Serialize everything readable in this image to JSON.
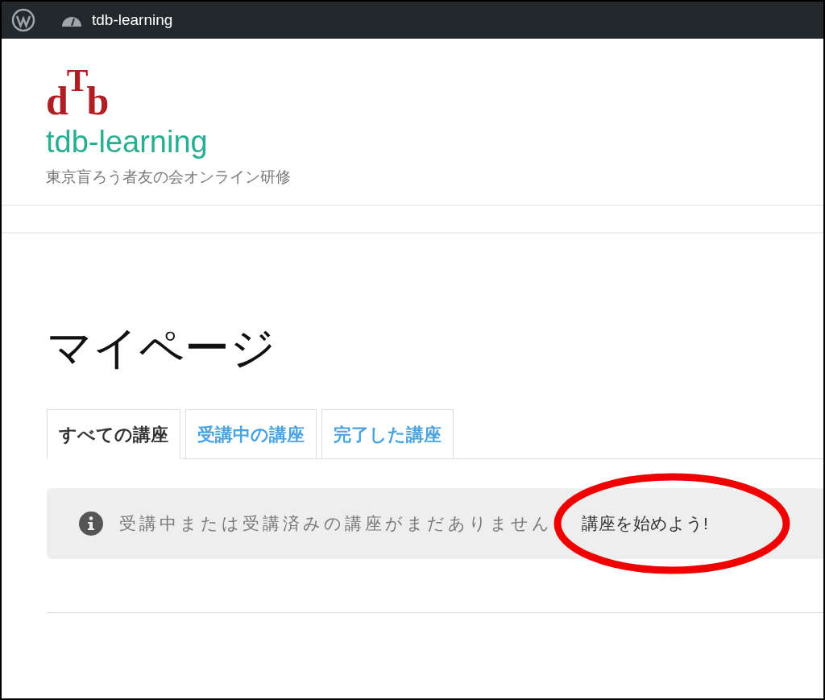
{
  "admin_bar": {
    "site_name": "tdb-learning"
  },
  "header": {
    "logo_letters": [
      "d",
      "T",
      "b"
    ],
    "site_title": "tdb-learning",
    "tagline": "東京盲ろう者友の会オンライン研修"
  },
  "page": {
    "title": "マイページ"
  },
  "tabs": [
    {
      "label": "すべての講座",
      "selected": true
    },
    {
      "label": "受講中の講座",
      "selected": false
    },
    {
      "label": "完了した講座",
      "selected": false
    }
  ],
  "notice": {
    "message": "受講中または受講済みの講座がまだありません",
    "link": "講座を始めよう!",
    "highlighted": true
  }
}
